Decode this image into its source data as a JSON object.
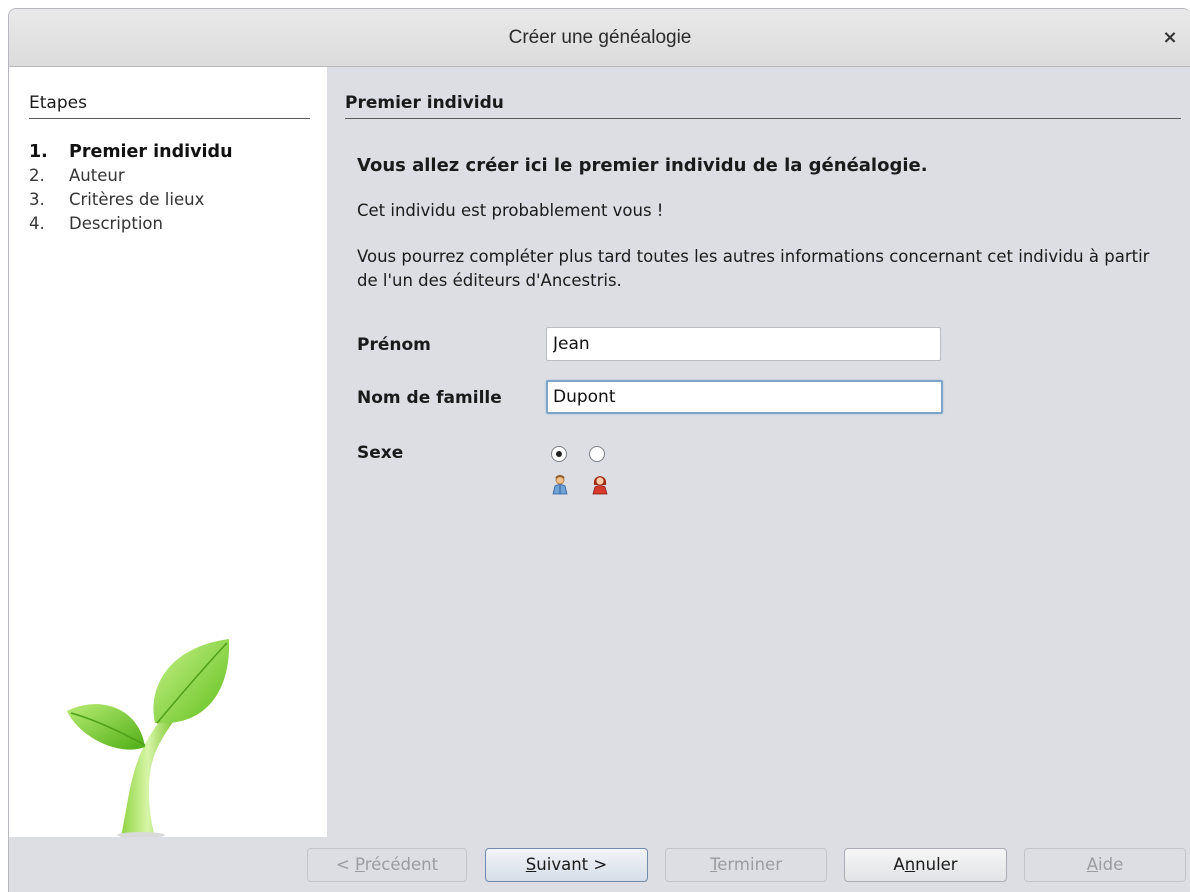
{
  "window": {
    "title": "Créer une généalogie",
    "close_glyph": "×"
  },
  "sidebar": {
    "heading": "Etapes",
    "steps": [
      {
        "num": "1.",
        "label": "Premier individu"
      },
      {
        "num": "2.",
        "label": "Auteur"
      },
      {
        "num": "3.",
        "label": "Critères de lieux"
      },
      {
        "num": "4.",
        "label": "Description"
      }
    ],
    "image": "sprout-plant-image"
  },
  "content": {
    "section_title": "Premier individu",
    "intro_bold": "Vous allez créer ici le premier individu de la généalogie.",
    "intro": "Cet individu est probablement vous !",
    "intro2": "Vous pourrez compléter plus tard toutes les autres informations concernant cet individu à partir de l'un des éditeurs d'Ancestris.",
    "fields": {
      "firstname": {
        "label": "Prénom",
        "value": "Jean"
      },
      "lastname": {
        "label": "Nom de famille",
        "value": "Dupont"
      },
      "sex": {
        "label": "Sexe",
        "selected": "male",
        "options": [
          "male-icon",
          "female-icon"
        ]
      }
    }
  },
  "buttons": {
    "previous": {
      "pre": "< ",
      "mnemonic": "P",
      "rest": "récédent"
    },
    "next": {
      "mnemonic": "S",
      "rest": "uivant >"
    },
    "finish": {
      "mnemonic": "T",
      "rest": "erminer"
    },
    "cancel": {
      "pre": "A",
      "mnemonic": "n",
      "rest": "nuler"
    },
    "help": {
      "mnemonic": "A",
      "rest": "ide"
    }
  },
  "colors": {
    "accent": "#7ea3c9",
    "panel": "#dcdee3",
    "sidebar": "#ffffff"
  }
}
